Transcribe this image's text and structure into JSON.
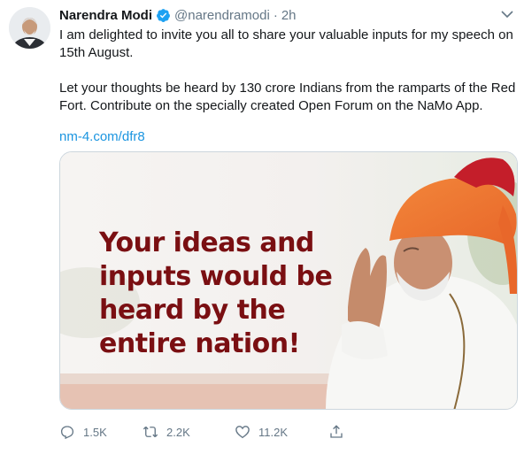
{
  "tweet": {
    "author": {
      "display_name": "Narendra Modi",
      "handle": "@narendramodi",
      "verified": true
    },
    "separator": "·",
    "timestamp": "2h",
    "text": {
      "paragraph_1": "I am delighted to invite you all to share your valuable inputs for my speech on 15th August.",
      "paragraph_2": "Let your thoughts be heard by 130 crore Indians from the ramparts of the Red Fort. Contribute on the specially created Open Forum on the NaMo App."
    },
    "link": "nm-4.com/dfr8",
    "media": {
      "headline_lines": [
        "Your ideas and",
        "inputs would be",
        "heard by the",
        "entire nation!"
      ],
      "headline_color": "#7a0f12"
    },
    "actions": {
      "reply_count": "1.5K",
      "retweet_count": "2.2K",
      "like_count": "11.2K"
    },
    "icons": {
      "reply": "reply-icon",
      "retweet": "retweet-icon",
      "like": "heart-icon",
      "share": "share-icon",
      "caret": "chevron-down-icon",
      "verified": "verified-badge-icon"
    },
    "colors": {
      "text": "#14171a",
      "secondary": "#657786",
      "link": "#1b95e0",
      "verified": "#1da1f2"
    }
  }
}
